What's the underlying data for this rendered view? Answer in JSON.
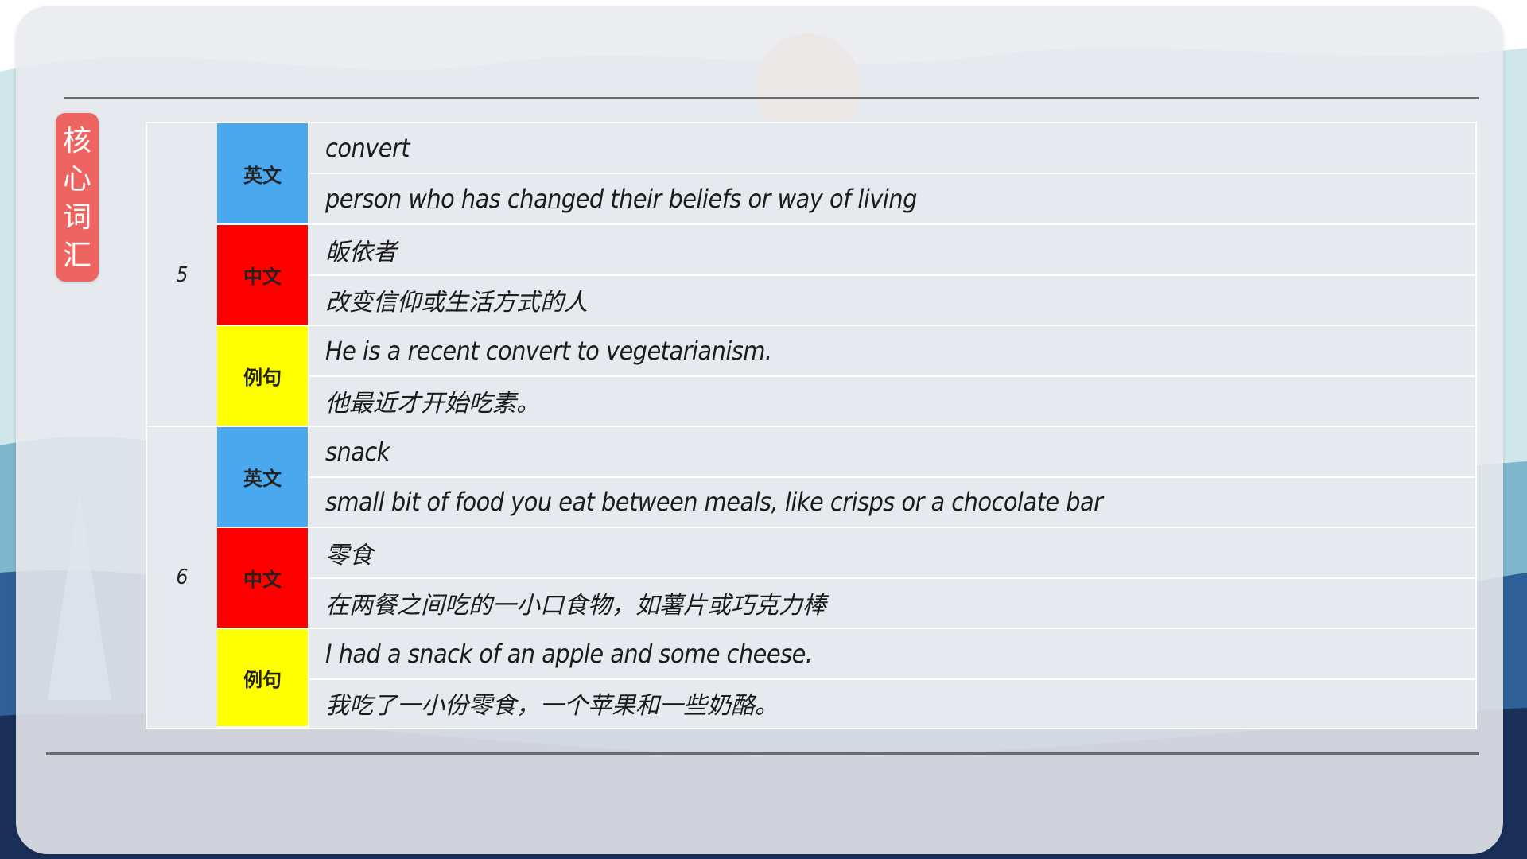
{
  "section_badge": {
    "text": "核心词汇"
  },
  "colors": {
    "english_label": "#4aa8ee",
    "chinese_label": "#ff0000",
    "example_label": "#ffff00",
    "badge": "#ee6460",
    "divider": "#6b6b6b"
  },
  "vocabulary": [
    {
      "number": "5",
      "english_label": "英文",
      "chinese_label": "中文",
      "example_label": "例句",
      "word": "convert",
      "definition": "person who has changed their beliefs or way of living",
      "chinese_word": "皈依者",
      "chinese_definition": "改变信仰或生活方式的人",
      "example_en": "He is a recent convert to vegetarianism.",
      "example_zh": "他最近才开始吃素。"
    },
    {
      "number": "6",
      "english_label": "英文",
      "chinese_label": "中文",
      "example_label": "例句",
      "word": "snack",
      "definition": "small bit of food you eat between meals, like crisps or a chocolate bar",
      "chinese_word": "零食",
      "chinese_definition": "在两餐之间吃的一小口食物，如薯片或巧克力棒",
      "example_en": "I had a snack of an apple and some cheese.",
      "example_zh": "我吃了一小份零食，一个苹果和一些奶酪。"
    }
  ]
}
